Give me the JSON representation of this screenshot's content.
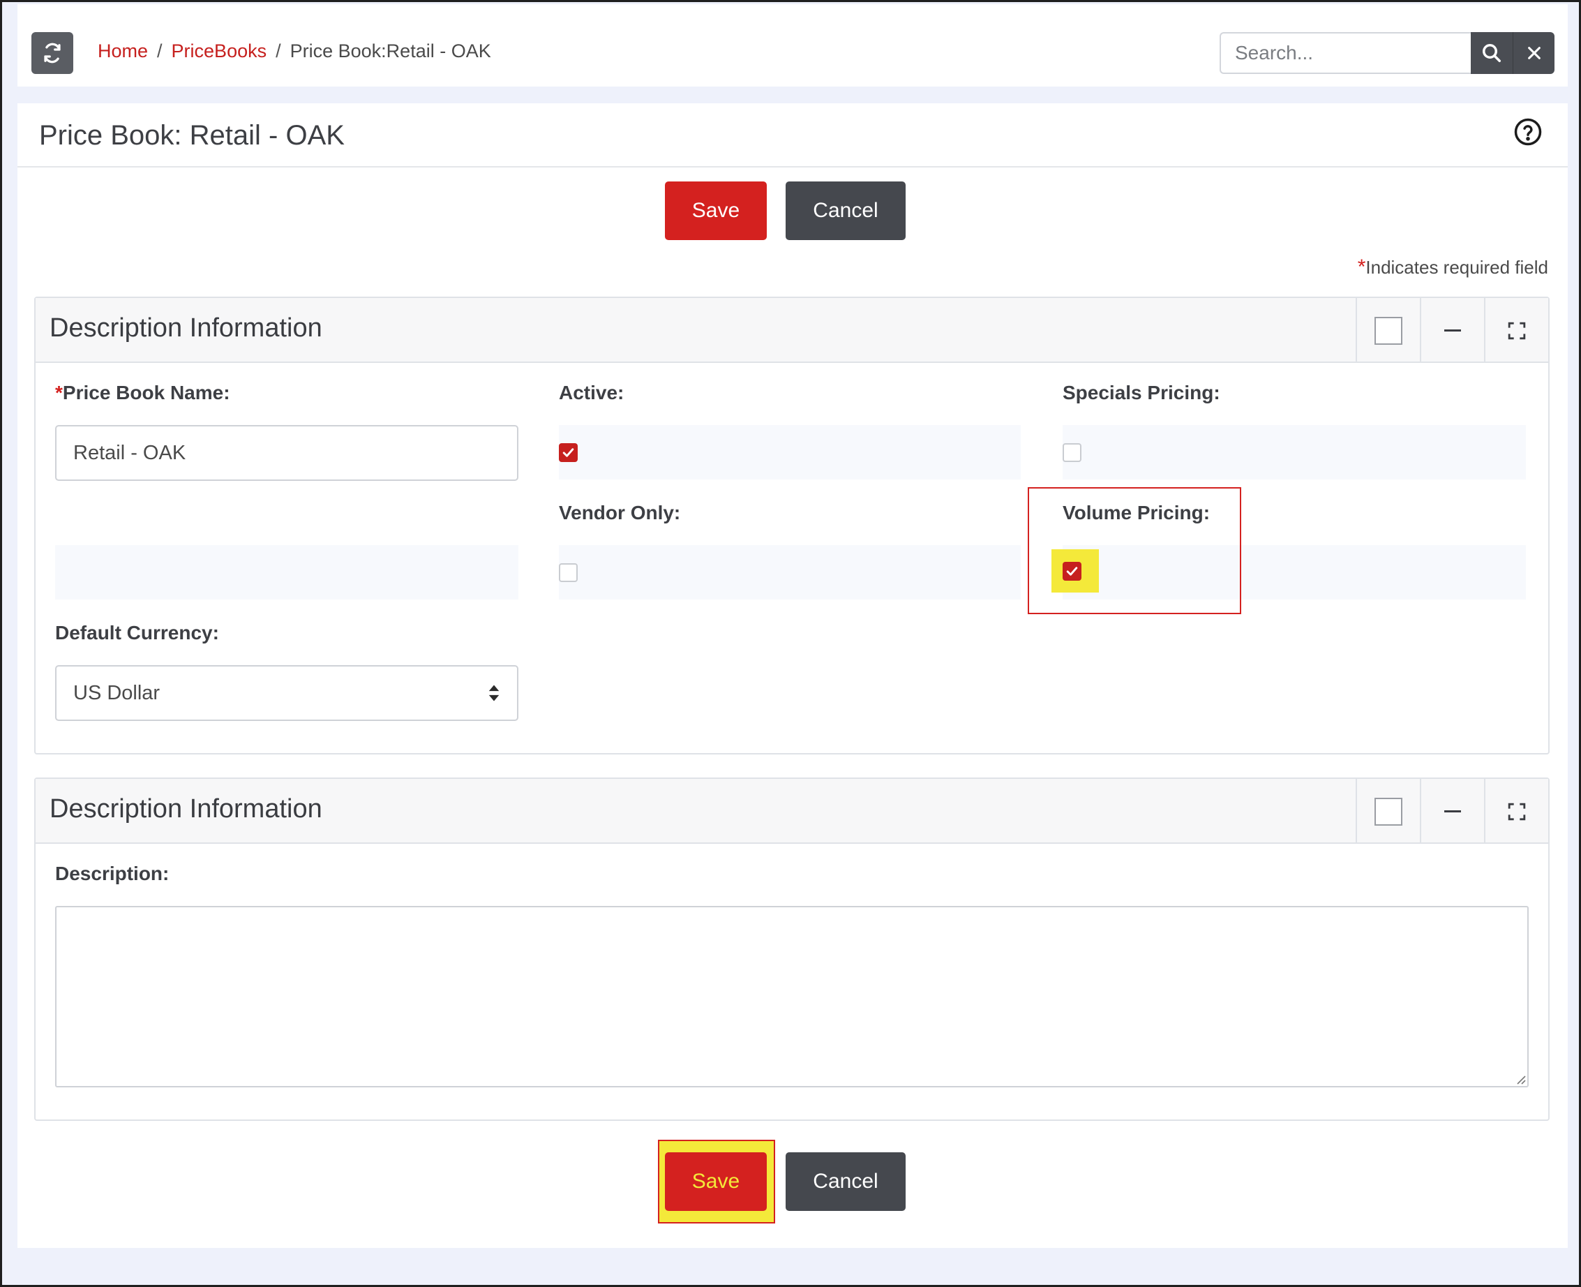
{
  "header": {
    "breadcrumb": {
      "home": "Home",
      "separator": "/",
      "pricebooks": "PriceBooks",
      "current": "Price Book:Retail - OAK"
    },
    "search": {
      "placeholder": "Search...",
      "value": ""
    }
  },
  "page": {
    "title": "Price Book: Retail - OAK",
    "required_star": "*",
    "required_note": "Indicates required field"
  },
  "actions": {
    "save_label": "Save",
    "cancel_label": "Cancel"
  },
  "sections": [
    {
      "title": "Description Information",
      "fields": {
        "price_book_name": {
          "label": "Price Book Name:",
          "required": "*",
          "value": "Retail - OAK"
        },
        "active": {
          "label": "Active:",
          "checked": true
        },
        "specials_pricing": {
          "label": "Specials Pricing:",
          "checked": false
        },
        "vendor_only": {
          "label": "Vendor Only:",
          "checked": false
        },
        "volume_pricing": {
          "label": "Volume Pricing:",
          "checked": true
        },
        "default_currency": {
          "label": "Default Currency:",
          "value": "US Dollar"
        }
      }
    },
    {
      "title": "Description Information",
      "fields": {
        "description": {
          "label": "Description:",
          "value": ""
        }
      }
    }
  ],
  "colors": {
    "accent_red": "#d4211f",
    "dark_button": "#45484e",
    "highlight_yellow": "#f4e93a"
  },
  "icons": {
    "refresh": "refresh-icon",
    "search": "search-icon",
    "clear": "close-icon",
    "help": "help-icon",
    "minimize": "minus-icon",
    "expand": "expand-icon",
    "select": "sort-arrows-icon"
  }
}
